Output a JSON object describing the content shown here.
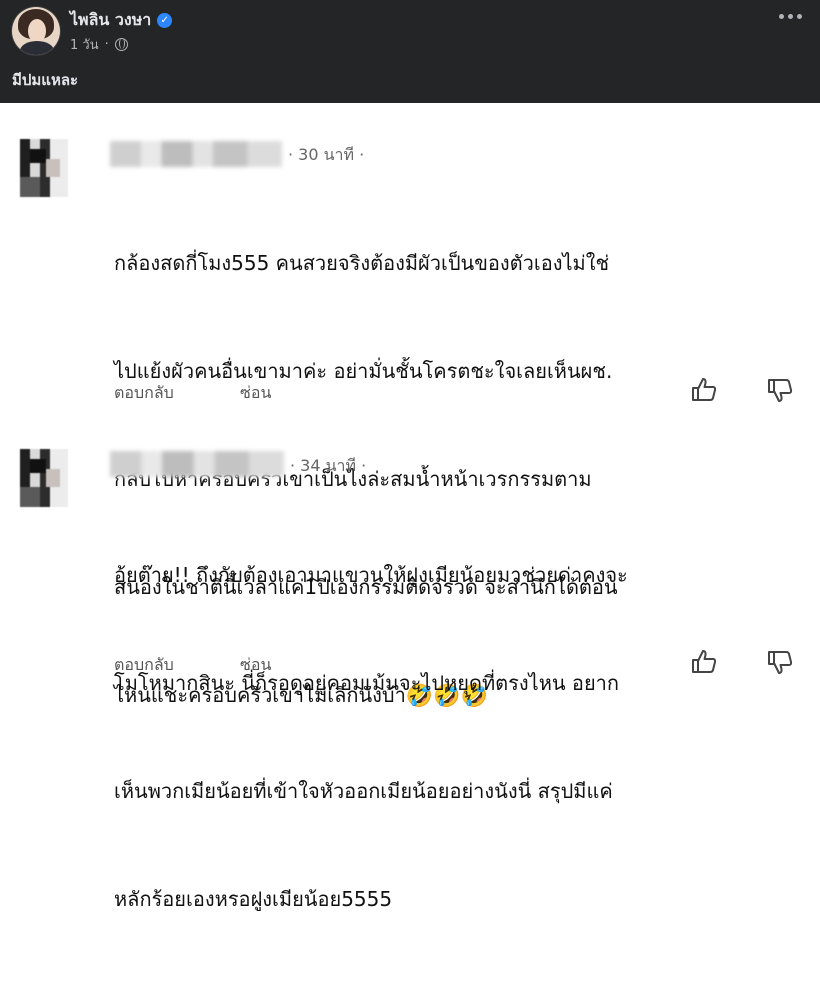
{
  "post": {
    "author": "ไพลิน วงษา",
    "time": "1 วัน",
    "text": "มีปมแหละ"
  },
  "comments": [
    {
      "time": "· 30 นาที ·",
      "text_lines": [
        "กล้องสดกี่โมง555 คนสวยจริงต้องมีผัวเป็นของตัวเองไม่ใช่",
        "ไปแย้งผัวคนอื่นเขามาค่ะ อย่ามั่นชั้นโครตชะใจเลยเห็นผช.",
        "กลับไปหาครอบครัวเขาเป็นไงล่ะสมน้ำหน้าเวรกรรมตาม",
        "สนองในชาตินี้เวลาแค่1ปีเองกรรมติดจรวด จะสำนึกได้ตอน",
        "ไหนแชะครอบครัวเขาไม่เลิกนังบ้า"
      ],
      "emojis": "🤣🤣🤣",
      "reply_label": "ตอบกลับ",
      "hide_label": "ซ่อน"
    },
    {
      "time": "· 34 นาที ·",
      "text_lines": [
        "อุ้ยต๊าย!! ถึงกับต้องเอามาแขวนให้ฝูงเมียน้อยมาช่วยด่าคงจะ",
        "โมโหมากสินะ นี่ก็รอดูอยู่คอมเม้นจะไปหยุดที่ตรงไหน อยาก",
        "เห็นพวกเมียน้อยที่เข้าใจหัวออกเมียน้อยอย่างนังนี่ สรุปมีแค่",
        "หลักร้อยเองหรอฝูงเมียน้อย5555"
      ],
      "reply_label": "ตอบกลับ",
      "hide_label": "ซ่อน"
    }
  ],
  "icons": {
    "verified": "verified-badge-icon",
    "globe": "globe-icon",
    "more": "more-options-icon",
    "like": "thumbs-up-icon",
    "dislike": "thumbs-down-icon"
  },
  "colors": {
    "header_bg": "#242526",
    "verified_blue": "#2d88ff"
  }
}
